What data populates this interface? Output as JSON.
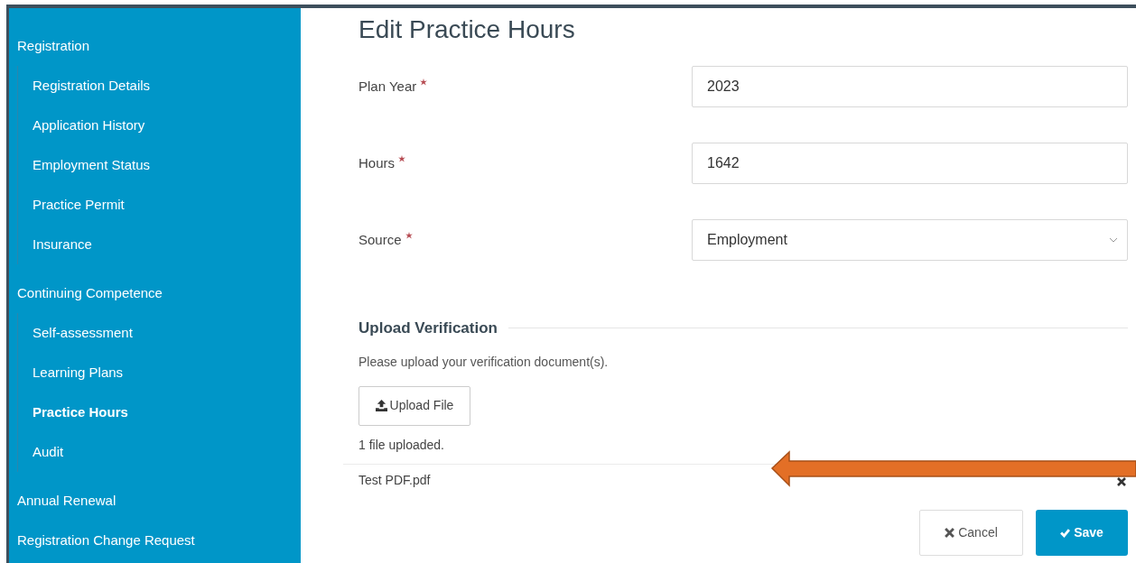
{
  "sidebar": {
    "sections": [
      {
        "label": "Registration",
        "selected": false,
        "children": [
          {
            "label": "Registration Details",
            "selected": false
          },
          {
            "label": "Application History",
            "selected": false
          },
          {
            "label": "Employment Status",
            "selected": false
          },
          {
            "label": "Practice Permit",
            "selected": false
          },
          {
            "label": "Insurance",
            "selected": false
          }
        ]
      },
      {
        "label": "Continuing Competence",
        "selected": false,
        "children": [
          {
            "label": "Self-assessment",
            "selected": false
          },
          {
            "label": "Learning Plans",
            "selected": false
          },
          {
            "label": "Practice Hours",
            "selected": true
          },
          {
            "label": "Audit",
            "selected": false
          }
        ]
      },
      {
        "label": "Annual Renewal",
        "selected": false
      },
      {
        "label": "Registration Change Request",
        "selected": false
      }
    ]
  },
  "page_title": "Edit Practice Hours",
  "fields": [
    {
      "kind": "text",
      "label": "Plan Year",
      "required": true,
      "value": "2023"
    },
    {
      "kind": "text",
      "label": "Hours",
      "required": true,
      "value": "1642"
    },
    {
      "kind": "select",
      "label": "Source",
      "required": true,
      "value": "Employment"
    }
  ],
  "upload": {
    "heading": "Upload Verification",
    "instructions": "Please upload your verification document(s).",
    "button": "Upload File",
    "status": "1 file uploaded.",
    "files": [
      {
        "name": "Test PDF.pdf"
      }
    ]
  },
  "annotation": {
    "kind": "arrow"
  },
  "buttons": [
    {
      "kind": "cancel",
      "label": "Cancel"
    },
    {
      "kind": "save",
      "label": "Save"
    }
  ]
}
